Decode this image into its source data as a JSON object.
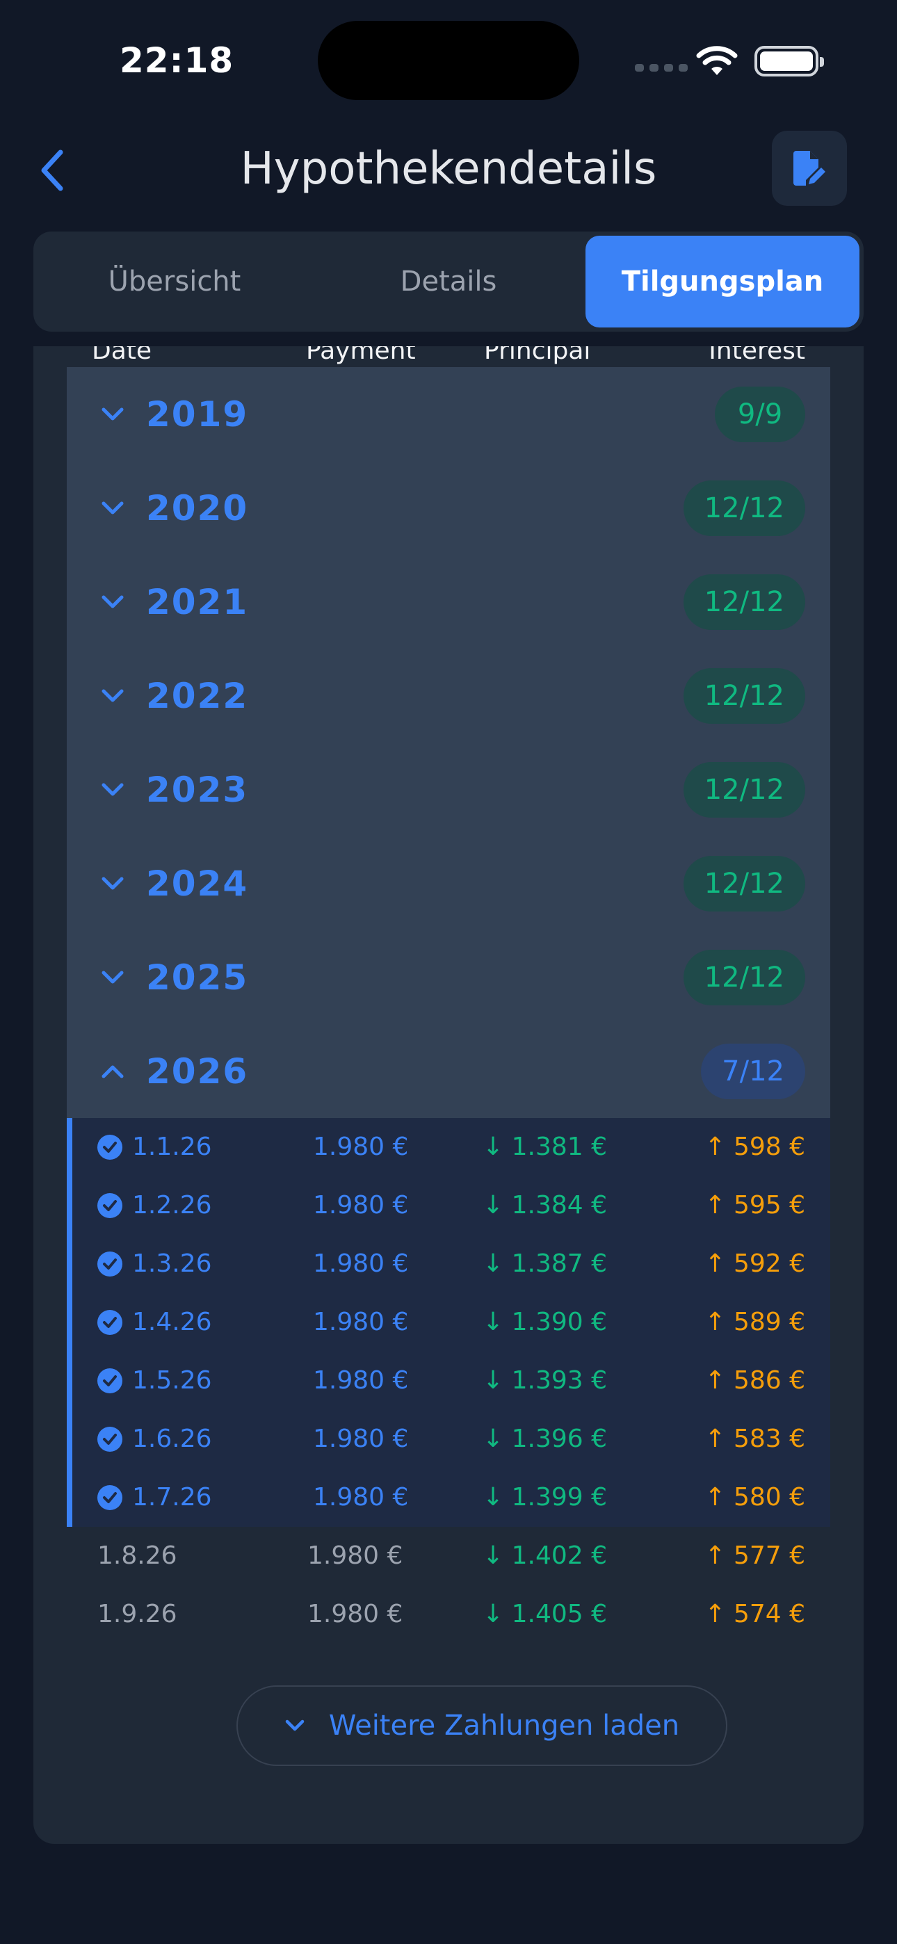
{
  "status_bar": {
    "time": "22:18",
    "signal_icon": "cellular-signal-icon",
    "wifi_icon": "wifi-icon",
    "battery_icon": "battery-icon"
  },
  "header": {
    "title": "Hypothekendetails",
    "back_icon": "chevron-left-icon",
    "edit_icon": "document-edit-icon"
  },
  "tabs": [
    {
      "label": "Übersicht",
      "active": false
    },
    {
      "label": "Details",
      "active": false
    },
    {
      "label": "Tilgungsplan",
      "active": true
    }
  ],
  "table": {
    "columns": [
      "Date",
      "Payment",
      "Principal",
      "Interest"
    ],
    "years": [
      {
        "year": "2019",
        "progress": "9/9",
        "expanded": false,
        "complete": true
      },
      {
        "year": "2020",
        "progress": "12/12",
        "expanded": false,
        "complete": true
      },
      {
        "year": "2021",
        "progress": "12/12",
        "expanded": false,
        "complete": true
      },
      {
        "year": "2022",
        "progress": "12/12",
        "expanded": false,
        "complete": true
      },
      {
        "year": "2023",
        "progress": "12/12",
        "expanded": false,
        "complete": true
      },
      {
        "year": "2024",
        "progress": "12/12",
        "expanded": false,
        "complete": true
      },
      {
        "year": "2025",
        "progress": "12/12",
        "expanded": false,
        "complete": true
      },
      {
        "year": "2026",
        "progress": "7/12",
        "expanded": true,
        "complete": false
      }
    ],
    "payments": [
      {
        "date": "1.1.26",
        "payment": "1.980 €",
        "principal": "1.381 €",
        "interest": "598 €",
        "paid": true
      },
      {
        "date": "1.2.26",
        "payment": "1.980 €",
        "principal": "1.384 €",
        "interest": "595 €",
        "paid": true
      },
      {
        "date": "1.3.26",
        "payment": "1.980 €",
        "principal": "1.387 €",
        "interest": "592 €",
        "paid": true
      },
      {
        "date": "1.4.26",
        "payment": "1.980 €",
        "principal": "1.390 €",
        "interest": "589 €",
        "paid": true
      },
      {
        "date": "1.5.26",
        "payment": "1.980 €",
        "principal": "1.393 €",
        "interest": "586 €",
        "paid": true
      },
      {
        "date": "1.6.26",
        "payment": "1.980 €",
        "principal": "1.396 €",
        "interest": "583 €",
        "paid": true
      },
      {
        "date": "1.7.26",
        "payment": "1.980 €",
        "principal": "1.399 €",
        "interest": "580 €",
        "paid": true
      },
      {
        "date": "1.8.26",
        "payment": "1.980 €",
        "principal": "1.402 €",
        "interest": "577 €",
        "paid": false
      },
      {
        "date": "1.9.26",
        "payment": "1.980 €",
        "principal": "1.405 €",
        "interest": "574 €",
        "paid": false
      }
    ],
    "principal_arrow": "↓",
    "interest_arrow": "↑"
  },
  "load_more": {
    "label": "Weitere Zahlungen laden",
    "icon": "chevron-down-icon"
  },
  "colors": {
    "accent": "#3b82f6",
    "green": "#10b981",
    "orange": "#f59e0b",
    "background": "#111827",
    "card": "#1f2937"
  }
}
